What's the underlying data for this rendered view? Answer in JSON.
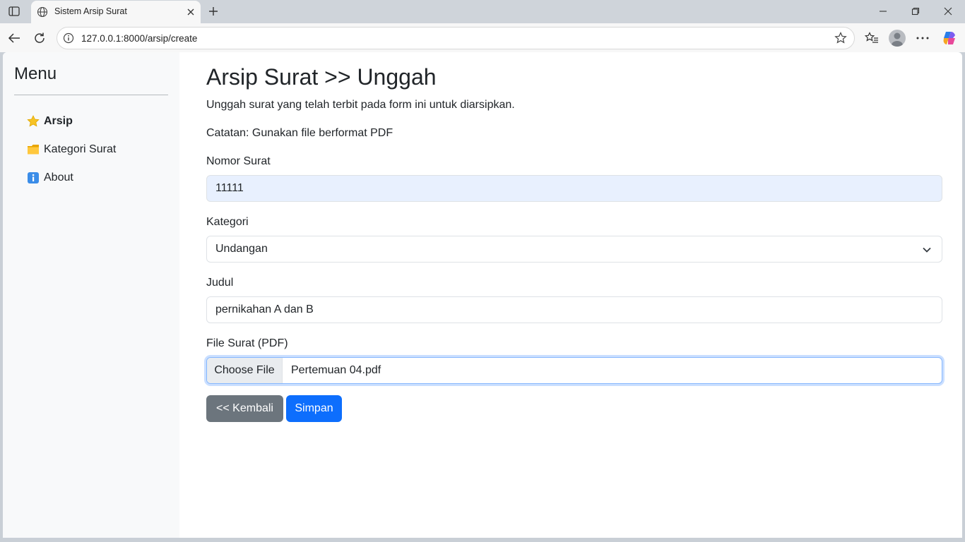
{
  "browser": {
    "tab_title": "Sistem Arsip Surat",
    "url": "127.0.0.1:8000/arsip/create",
    "icons": [
      "sidebar-toggle-icon",
      "globe-icon",
      "close-icon",
      "plus-icon",
      "minimize-icon",
      "restore-icon",
      "window-close-icon",
      "back-arrow-icon",
      "reload-icon",
      "info-icon",
      "star-icon",
      "favorites-icon",
      "profile-icon",
      "more-icon",
      "copilot-icon"
    ]
  },
  "sidebar": {
    "title": "Menu",
    "items": [
      {
        "label": "Arsip",
        "icon": "star-icon",
        "active": true
      },
      {
        "label": "Kategori Surat",
        "icon": "folder-icon",
        "active": false
      },
      {
        "label": "About",
        "icon": "info-icon",
        "active": false
      }
    ]
  },
  "main": {
    "title": "Arsip Surat >> Unggah",
    "description": "Unggah surat yang telah terbit pada form ini untuk diarsipkan.",
    "note": "Catatan: Gunakan file berformat PDF",
    "fields": {
      "nomor": {
        "label": "Nomor Surat",
        "value": "11111"
      },
      "kategori": {
        "label": "Kategori",
        "value": "Undangan"
      },
      "judul": {
        "label": "Judul",
        "value": "pernikahan A dan B"
      },
      "file": {
        "label": "File Surat (PDF)",
        "button": "Choose File",
        "value": "Pertemuan 04.pdf"
      }
    },
    "buttons": {
      "back": "<< Kembali",
      "save": "Simpan"
    }
  },
  "colors": {
    "primary": "#0d6efd",
    "secondary": "#6c757d",
    "autofill": "#e8f0fe",
    "sidebar_bg": "#f8f9fa"
  }
}
